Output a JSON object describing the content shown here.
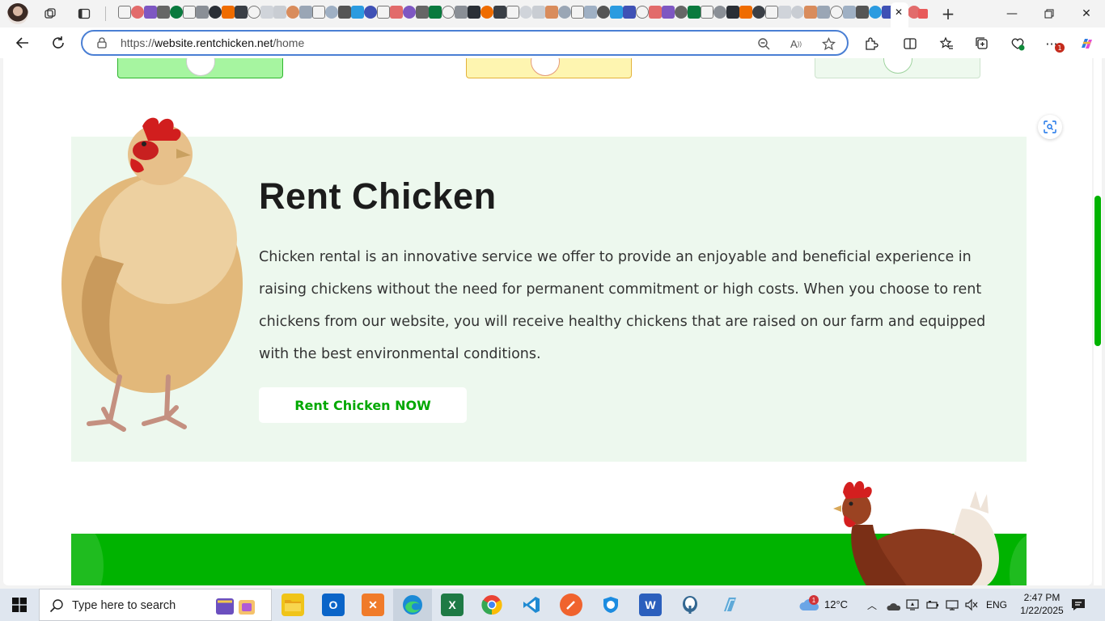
{
  "browser": {
    "address_url_prefix": "https://",
    "address_url_host": "website.rentchicken.net",
    "address_url_path": "/home",
    "menu_badge_count": "1"
  },
  "hero": {
    "title": "Rent Chicken",
    "description": "Chicken rental is an innovative service we offer to provide an enjoyable and beneficial experience in raising chickens without the need for permanent commitment or high costs. When you choose to rent chickens from our website, you will receive healthy chickens that are raised on our farm and equipped with the best environmental conditions.",
    "cta_label": "Rent Chicken NOW"
  },
  "colors": {
    "brand_green": "#00b300",
    "cta_text": "#00a800",
    "hero_bg": "#edf8ee",
    "card_green": "#a6f5a0",
    "card_yellow": "#fef5b0",
    "card_light": "#eef9ee"
  },
  "taskbar": {
    "search_placeholder": "Type here to search",
    "weather_temp": "12°C",
    "weather_badge": "1",
    "language": "ENG",
    "time": "2:47 PM",
    "date": "1/22/2025"
  },
  "icons": {
    "start": "windows-logo-icon",
    "search": "search-icon",
    "scan": "visual-search-icon"
  }
}
